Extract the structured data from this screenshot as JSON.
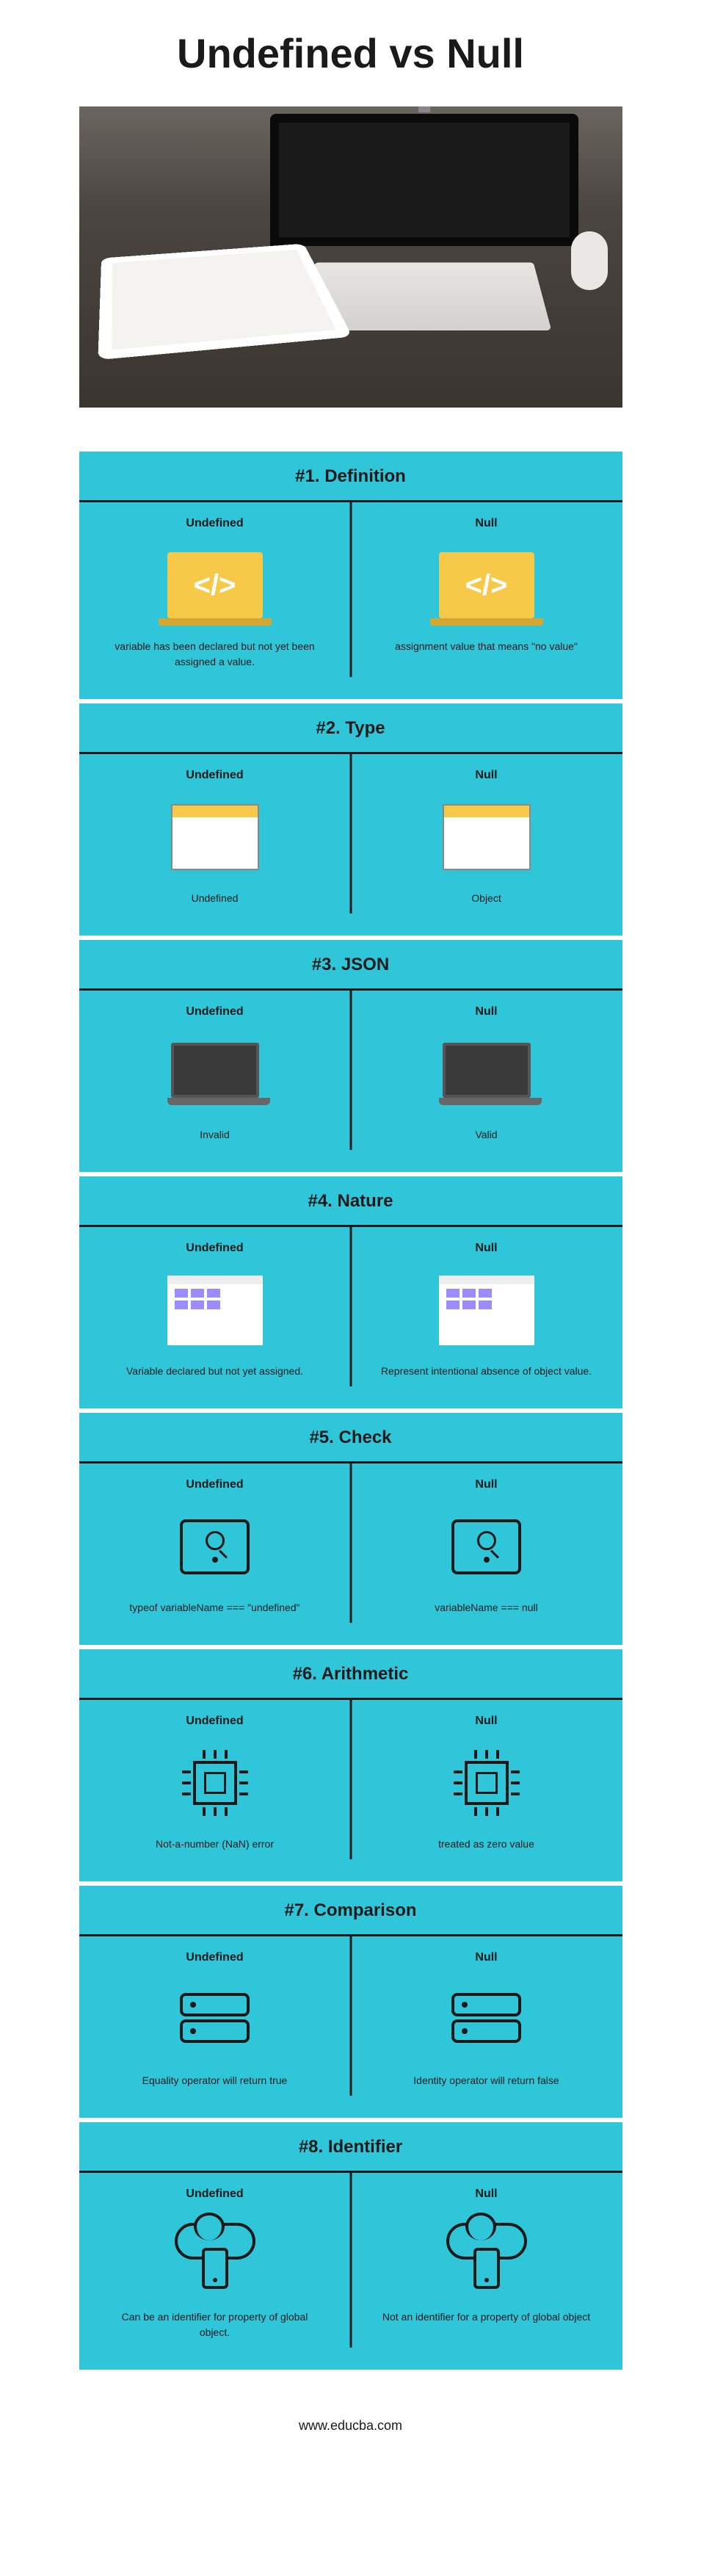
{
  "title": "Undefined vs Null",
  "footer_url": "www.educba.com",
  "col_labels": {
    "left": "Undefined",
    "right": "Null"
  },
  "sections": [
    {
      "title": "#1. Definition",
      "icon": "laptop-code",
      "left": "variable has been declared but not yet been assigned a value.",
      "right": "assignment value that means \"no value\""
    },
    {
      "title": "#2. Type",
      "icon": "browser",
      "left": "Undefined",
      "right": "Object"
    },
    {
      "title": "#3. JSON",
      "icon": "laptop-dark",
      "left": "Invalid",
      "right": "Valid"
    },
    {
      "title": "#4. Nature",
      "icon": "browser-grid",
      "left": "Variable declared but not yet assigned.",
      "right": "Represent intentional absence of object value."
    },
    {
      "title": "#5. Check",
      "icon": "scanner",
      "left": "typeof variableName === \"undefined\"",
      "right": "variableName === null"
    },
    {
      "title": "#6. Arithmetic",
      "icon": "cpu",
      "left": "Not-a-number (NaN) error",
      "right": "treated as zero value"
    },
    {
      "title": "#7. Comparison",
      "icon": "server",
      "left": "Equality operator will return true",
      "right": "Identity operator will return false"
    },
    {
      "title": "#8. Identifier",
      "icon": "cloud-phone",
      "left": "Can be an identifier for property of global object.",
      "right": "Not an identifier for a property of global object"
    }
  ]
}
